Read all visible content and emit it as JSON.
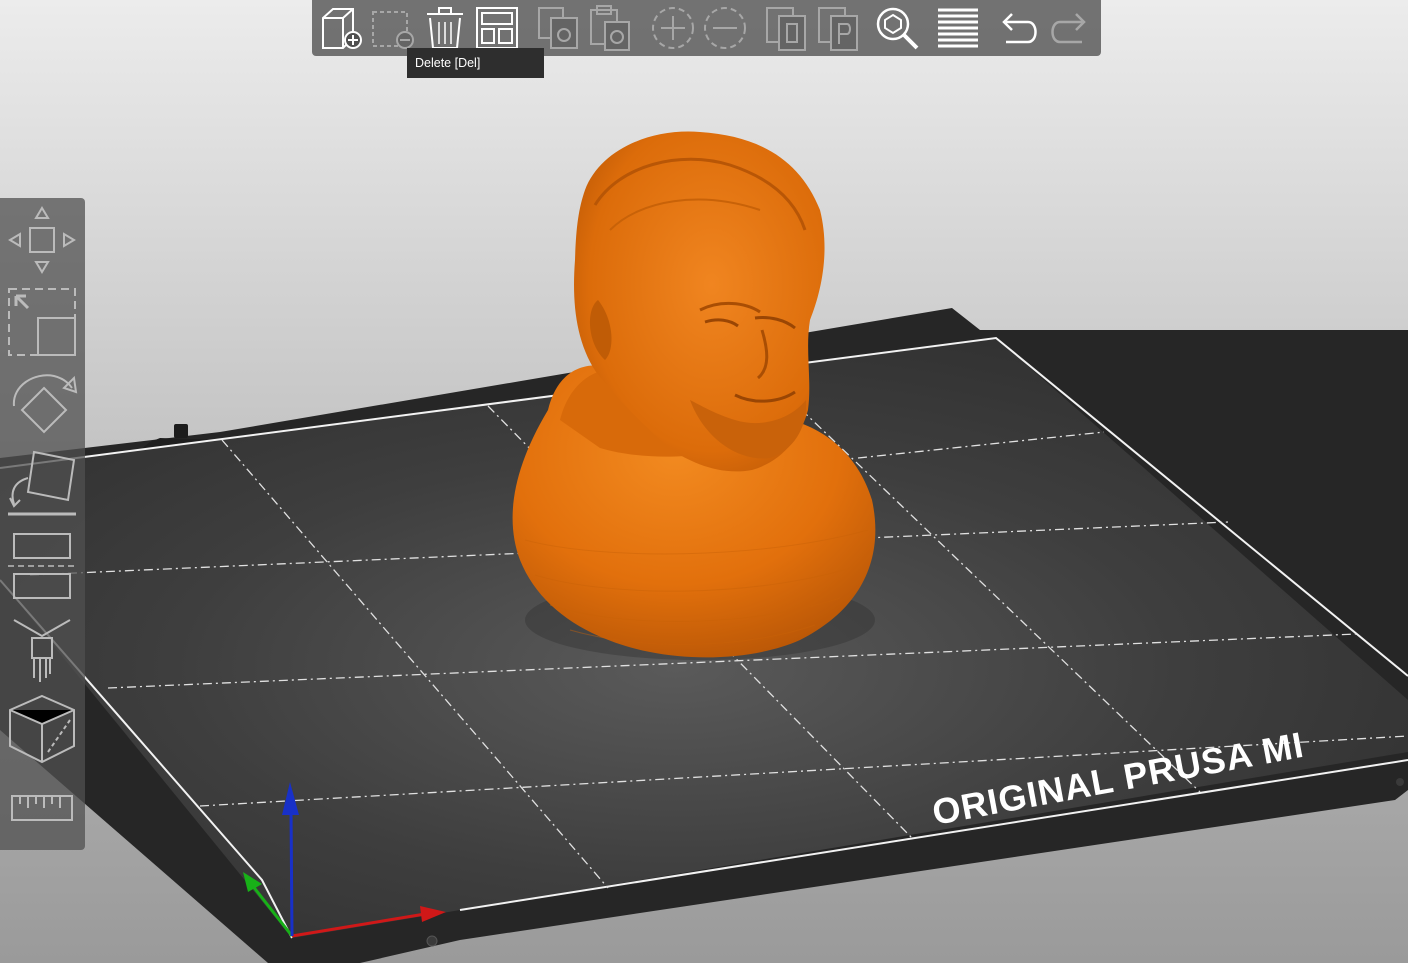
{
  "toolbar": {
    "buttons": [
      {
        "name": "add",
        "icon": "add-object-icon",
        "enabled": true
      },
      {
        "name": "delete",
        "icon": "delete-icon",
        "enabled": false
      },
      {
        "name": "delete-all",
        "icon": "delete-all-icon",
        "enabled": true
      },
      {
        "name": "arrange",
        "icon": "arrange-icon",
        "enabled": true
      },
      {
        "name": "copy",
        "icon": "copy-icon",
        "enabled": false
      },
      {
        "name": "paste",
        "icon": "paste-icon",
        "enabled": false
      },
      {
        "name": "add-instance",
        "icon": "add-instance-icon",
        "enabled": false
      },
      {
        "name": "remove-instance",
        "icon": "remove-instance-icon",
        "enabled": false
      },
      {
        "name": "split-objects",
        "icon": "split-objects-icon",
        "enabled": false
      },
      {
        "name": "split-parts",
        "icon": "split-parts-icon",
        "enabled": false
      },
      {
        "name": "search",
        "icon": "search-icon",
        "enabled": true
      },
      {
        "name": "layers-editing",
        "icon": "layers-editing-icon",
        "enabled": true
      },
      {
        "name": "undo",
        "icon": "undo-icon",
        "enabled": true
      },
      {
        "name": "redo",
        "icon": "redo-icon",
        "enabled": false
      }
    ]
  },
  "tooltip": {
    "text": "Delete [Del]"
  },
  "left_toolbar": {
    "tools": [
      {
        "name": "move",
        "icon": "move-icon"
      },
      {
        "name": "scale",
        "icon": "scale-icon"
      },
      {
        "name": "rotate",
        "icon": "rotate-icon"
      },
      {
        "name": "place-on-face",
        "icon": "place-on-face-icon"
      },
      {
        "name": "cut",
        "icon": "cut-icon"
      },
      {
        "name": "paint-supports",
        "icon": "paint-supports-icon"
      },
      {
        "name": "seam-painting",
        "icon": "seam-painting-icon"
      },
      {
        "name": "measure",
        "icon": "measure-icon"
      }
    ]
  },
  "bed": {
    "label": "ORIGINAL PRUSA MI"
  },
  "colors": {
    "model": "#e8740c",
    "bed": "#2c2c2c",
    "axis_x": "#d01818",
    "axis_y": "#18b018",
    "axis_z": "#1830c8",
    "toolbar_bg": "#505050"
  }
}
